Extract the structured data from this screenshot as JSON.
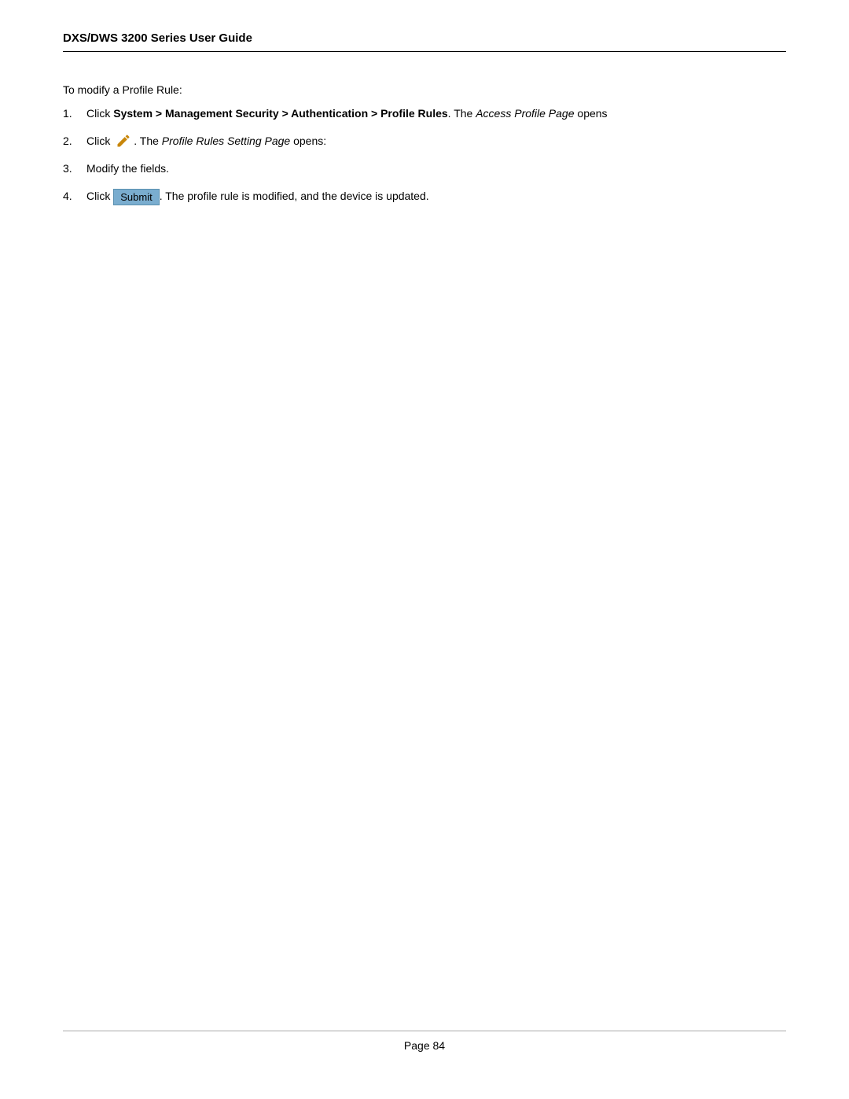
{
  "header": {
    "title": "DXS/DWS 3200 Series User Guide"
  },
  "intro": {
    "text": "To modify a Profile Rule:"
  },
  "steps": [
    {
      "number": "1.",
      "pre_bold": "Click ",
      "bold": "System > Management Security > Authentication > Profile Rules",
      "post": ". The ",
      "italic": "Access Profile Page",
      "post2": " opens"
    },
    {
      "number": "2.",
      "pre": "Click ",
      "icon": "edit",
      "post": ". The ",
      "italic": "Profile Rules Setting Page",
      "post2": " opens:"
    },
    {
      "number": "3.",
      "text": "Modify the fields."
    },
    {
      "number": "4.",
      "pre": "Click ",
      "button": "Submit",
      "post": ". The profile rule is modified, and the device is updated."
    }
  ],
  "footer": {
    "page_label": "Page 84"
  }
}
